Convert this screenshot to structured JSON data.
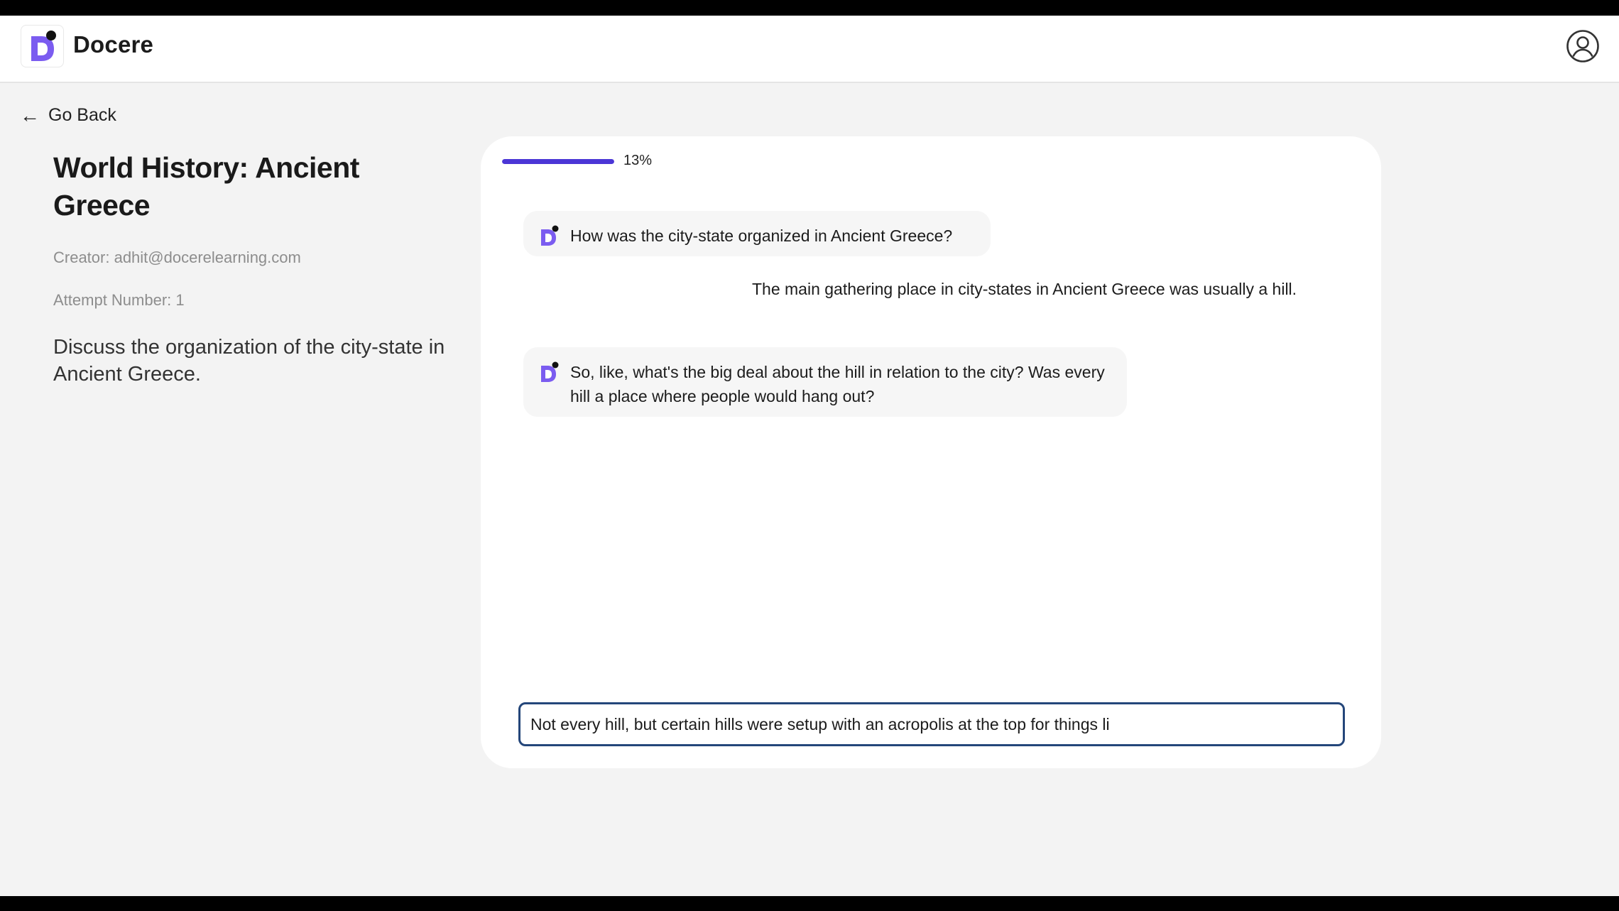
{
  "app": {
    "name": "Docere"
  },
  "nav": {
    "back_label": "Go Back"
  },
  "assignment": {
    "title": "World History: Ancient Greece",
    "creator": "Creator: adhit@docerelearning.com",
    "attempt": "Attempt Number: 1",
    "prompt": "Discuss the organization of the city-state in Ancient Greece."
  },
  "progress": {
    "label": "13%",
    "value_percent": 13
  },
  "conversation": [
    {
      "role": "bot",
      "text": "How was the city-state organized in Ancient Greece?"
    },
    {
      "role": "user",
      "text": "The main gathering place in city-states in Ancient Greece was usually a hill."
    },
    {
      "role": "bot",
      "text": "So, like, what's the big deal about the hill in relation to the city? Was every hill a place where people would hang out?"
    }
  ],
  "answer_input": {
    "value": "Not every hill, but certain hills were setup with an acropolis at the top for things li"
  },
  "colors": {
    "brand_purple": "#7b5cf0",
    "progress_fill": "#4b36d6",
    "input_border": "#24467a"
  }
}
